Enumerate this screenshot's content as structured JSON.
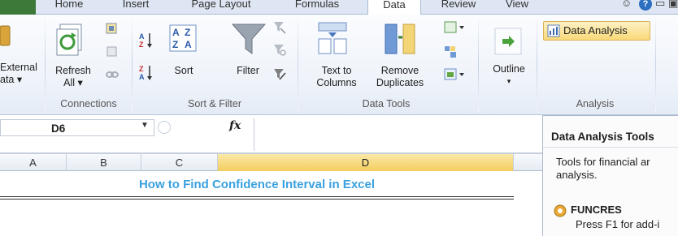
{
  "tabs": [
    "Home",
    "Insert",
    "Page Layout",
    "Formulas",
    "Data",
    "Review",
    "View"
  ],
  "active_tab": "Data",
  "ribbon": {
    "get_external": {
      "line1": "External",
      "line2": "ata ▾"
    },
    "connections": {
      "refresh_line1": "Refresh",
      "refresh_line2": "All ▾",
      "group_label": "Connections"
    },
    "sort_filter": {
      "sort": "Sort",
      "filter": "Filter",
      "group_label": "Sort & Filter"
    },
    "data_tools": {
      "text_to_line1": "Text to",
      "text_to_line2": "Columns",
      "remove_line1": "Remove",
      "remove_line2": "Duplicates",
      "group_label": "Data Tools"
    },
    "outline": {
      "label": "Outline",
      "arrow": "▾"
    },
    "analysis": {
      "button": "Data Analysis",
      "group_label": "Analysis"
    }
  },
  "formula_bar": {
    "name_box": "D6",
    "fx": "fx",
    "value": ""
  },
  "columns": [
    "A",
    "B",
    "C",
    "D"
  ],
  "selected_column": "D",
  "sheet": {
    "title": "How to Find Confidence Interval in Excel"
  },
  "panel": {
    "title": "Data Analysis Tools",
    "description": "Tools for financial ar analysis.",
    "desc_line1": "Tools for financial ar",
    "desc_line2": "analysis.",
    "item_name": "FUNCRES",
    "item_desc": "Press F1 for add-i"
  }
}
